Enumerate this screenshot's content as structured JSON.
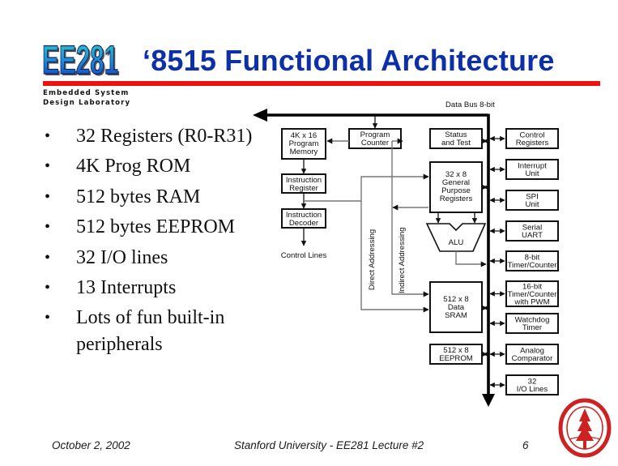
{
  "logo": {
    "text": "EE281",
    "subtitle_line1": "Embedded System",
    "subtitle_line2": "Design Laboratory"
  },
  "title": "‘8515 Functional Architecture",
  "colors": {
    "title": "#0d2fa8",
    "rule": "#ee1111",
    "seal": "#cc2222"
  },
  "bullets": [
    "32 Registers (R0-R31)",
    "4K Prog ROM",
    "512 bytes RAM",
    "512 bytes EEPROM",
    "32 I/O lines",
    "13 Interrupts",
    "Lots of fun built-in peripherals"
  ],
  "bullets_wrapped_line2": "peripherals",
  "bullets_last_line1": "Lots of fun built-in",
  "diagram": {
    "bus_label": "Data Bus 8-bit",
    "blocks": {
      "program_memory": [
        "4K x 16",
        "Program",
        "Memory"
      ],
      "program_counter": [
        "Program",
        "Counter"
      ],
      "instruction_register": [
        "Instruction",
        "Register"
      ],
      "instruction_decoder": [
        "Instruction",
        "Decoder"
      ],
      "status_and_test": [
        "Status",
        "and Test"
      ],
      "gp_registers": [
        "32 x 8",
        "General",
        "Purpose",
        "Registers"
      ],
      "alu": "ALU",
      "data_sram": [
        "512 x 8",
        "Data",
        "SRAM"
      ],
      "eeprom": [
        "512 x 8",
        "EEPROM"
      ]
    },
    "control_lines": "Control  Lines",
    "direct_addressing": "Direct Addressing",
    "indirect_addressing": "Indirect Addressing",
    "peripherals": [
      [
        "Control",
        "Registers"
      ],
      [
        "Interrupt",
        "Unit"
      ],
      [
        "SPI",
        "Unit"
      ],
      [
        "Serial",
        "UART"
      ],
      [
        "8-bit",
        "Timer/Counter"
      ],
      [
        "16-bit",
        "Timer/Counter",
        "with PWM"
      ],
      [
        "Watchdog",
        "Timer"
      ],
      [
        "Analog",
        "Comparator"
      ],
      [
        "32",
        "I/O Lines"
      ]
    ]
  },
  "footer": {
    "date": "October 2, 2002",
    "center": "Stanford University - EE281 Lecture #2",
    "page_number": "6"
  }
}
